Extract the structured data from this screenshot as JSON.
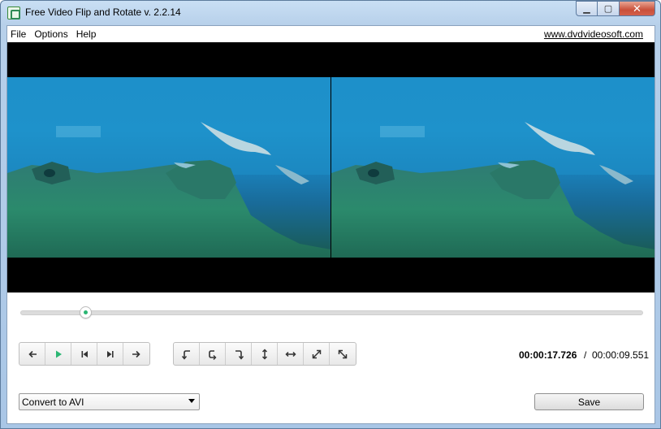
{
  "window": {
    "title": "Free Video Flip and Rotate v. 2.2.14",
    "controls": {
      "minimize": "▁",
      "maximize": "▢",
      "close": "✕"
    }
  },
  "menu": [
    "File",
    "Options",
    "Help"
  ],
  "site_link": "www.dvdvideosoft.com",
  "playback": {
    "position_fraction": 0.105,
    "buttons": [
      "arrow-left-icon",
      "play-icon",
      "skip-start-icon",
      "skip-end-icon",
      "arrow-right-icon"
    ]
  },
  "transform_buttons": [
    "rotate-left-icon",
    "rotate-180-icon",
    "rotate-right-icon",
    "flip-vertical-icon",
    "flip-horizontal-icon",
    "diagonal-flip-icon",
    "anti-diagonal-flip-icon"
  ],
  "time": {
    "current": "00:00:17.726",
    "separator": "/",
    "total": "00:00:09.551"
  },
  "output": {
    "format": "Convert to AVI",
    "save_label": "Save"
  },
  "colors": {
    "accent_green": "#2bb673",
    "title_gradient": "#b7d0ea"
  }
}
